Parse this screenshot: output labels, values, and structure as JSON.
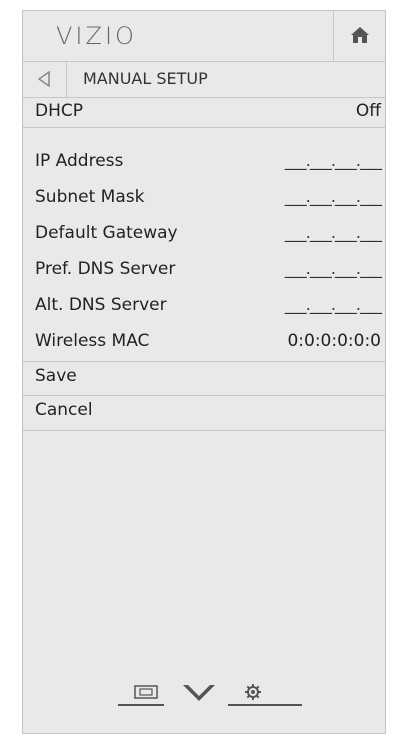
{
  "header": {
    "logo": "VIZIO"
  },
  "title": "MANUAL SETUP",
  "dhcp": {
    "label": "DHCP",
    "value": "Off"
  },
  "fields": [
    {
      "label": "IP Address",
      "value": "___.___.___.___"
    },
    {
      "label": "Subnet Mask",
      "value": "___.___.___.___"
    },
    {
      "label": "Default Gateway",
      "value": "___.___.___.___"
    },
    {
      "label": "Pref. DNS Server",
      "value": "___.___.___.___"
    },
    {
      "label": "Alt. DNS Server",
      "value": "___.___.___.___"
    }
  ],
  "wireless_mac": {
    "label": "Wireless MAC",
    "value": "0:0:0:0:0:0"
  },
  "actions": {
    "save": "Save",
    "cancel": "Cancel"
  },
  "icons": {
    "home": "home-icon",
    "back": "back-arrow-icon",
    "input": "input-icon",
    "down": "chevron-down-icon",
    "settings": "gear-icon"
  }
}
